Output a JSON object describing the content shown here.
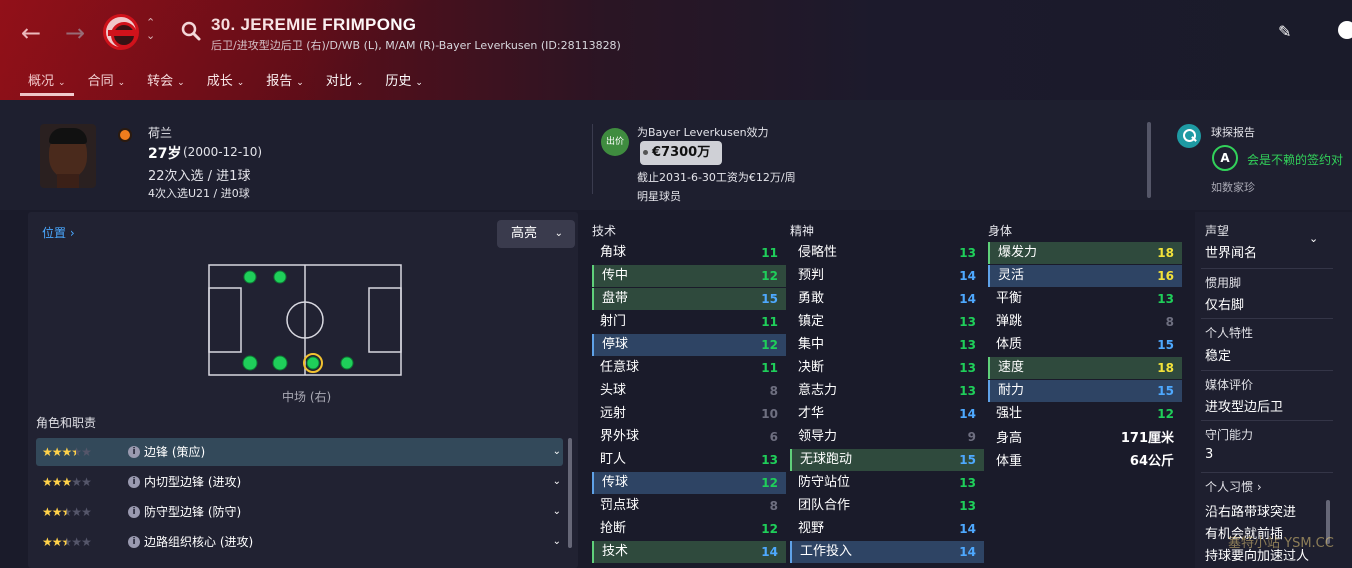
{
  "header": {
    "player_title": "30. JEREMIE FRIMPONG",
    "player_subtitle": "后卫/进攻型边后卫 (右)/D/WB (L), M/AM (R)-Bayer Leverkusen (ID:28113828)",
    "tabs": [
      {
        "label": "概况"
      },
      {
        "label": "合同"
      },
      {
        "label": "转会"
      },
      {
        "label": "成长"
      },
      {
        "label": "报告"
      },
      {
        "label": "对比"
      },
      {
        "label": "历史"
      }
    ],
    "icons": [
      "back-icon",
      "forward-icon",
      "club-crest",
      "up-down-icon",
      "search-icon",
      "edit-icon",
      "skull-icon"
    ]
  },
  "bio": {
    "nationality": "荷兰",
    "age": "27岁",
    "dob": "(2000-12-10)",
    "caps": "22次入选 / 进1球",
    "u21": "4次入选U21 / 进0球"
  },
  "contract": {
    "badge": "出价",
    "plays_for": "为Bayer Leverkusen效力",
    "value": "€7300万",
    "wage": "截止2031-6-30工资为€12万/周",
    "status": "明星球员"
  },
  "scout": {
    "title": "球探报告",
    "grade": "A",
    "verdict": "会是不赖的签约对",
    "scout_name": "如数家珍"
  },
  "position": {
    "link": "位置",
    "highlight_button": "高亮",
    "label": "中场 (右)"
  },
  "roles": {
    "title": "角色和职责",
    "items": [
      {
        "name": "边锋 (策应)",
        "stars": 3.5
      },
      {
        "name": "内切型边锋 (进攻)",
        "stars": 3
      },
      {
        "name": "防守型边锋 (防守)",
        "stars": 2.5
      },
      {
        "name": "边路组织核心 (进攻)",
        "stars": 2.5
      }
    ]
  },
  "attributes": {
    "technical": {
      "title": "技术",
      "items": [
        {
          "name": "角球",
          "value": "11",
          "hl": ""
        },
        {
          "name": "传中",
          "value": "12",
          "hl": "g"
        },
        {
          "name": "盘带",
          "value": "15",
          "hl": "g"
        },
        {
          "name": "射门",
          "value": "11",
          "hl": ""
        },
        {
          "name": "停球",
          "value": "12",
          "hl": "b"
        },
        {
          "name": "任意球",
          "value": "11",
          "hl": ""
        },
        {
          "name": "头球",
          "value": "8",
          "hl": ""
        },
        {
          "name": "远射",
          "value": "10",
          "hl": ""
        },
        {
          "name": "界外球",
          "value": "6",
          "hl": ""
        },
        {
          "name": "盯人",
          "value": "13",
          "hl": ""
        },
        {
          "name": "传球",
          "value": "12",
          "hl": "b"
        },
        {
          "name": "罚点球",
          "value": "8",
          "hl": ""
        },
        {
          "name": "抢断",
          "value": "12",
          "hl": ""
        },
        {
          "name": "技术",
          "value": "14",
          "hl": "g"
        }
      ]
    },
    "mental": {
      "title": "精神",
      "items": [
        {
          "name": "侵略性",
          "value": "13",
          "hl": ""
        },
        {
          "name": "预判",
          "value": "14",
          "hl": ""
        },
        {
          "name": "勇敢",
          "value": "14",
          "hl": ""
        },
        {
          "name": "镇定",
          "value": "13",
          "hl": ""
        },
        {
          "name": "集中",
          "value": "13",
          "hl": ""
        },
        {
          "name": "决断",
          "value": "13",
          "hl": ""
        },
        {
          "name": "意志力",
          "value": "13",
          "hl": ""
        },
        {
          "name": "才华",
          "value": "14",
          "hl": ""
        },
        {
          "name": "领导力",
          "value": "9",
          "hl": ""
        },
        {
          "name": "无球跑动",
          "value": "15",
          "hl": "g"
        },
        {
          "name": "防守站位",
          "value": "13",
          "hl": ""
        },
        {
          "name": "团队合作",
          "value": "13",
          "hl": ""
        },
        {
          "name": "视野",
          "value": "14",
          "hl": ""
        },
        {
          "name": "工作投入",
          "value": "14",
          "hl": "b"
        }
      ]
    },
    "physical": {
      "title": "身体",
      "items": [
        {
          "name": "爆发力",
          "value": "18",
          "hl": "g"
        },
        {
          "name": "灵活",
          "value": "16",
          "hl": "b"
        },
        {
          "name": "平衡",
          "value": "13",
          "hl": ""
        },
        {
          "name": "弹跳",
          "value": "8",
          "hl": ""
        },
        {
          "name": "体质",
          "value": "15",
          "hl": ""
        },
        {
          "name": "速度",
          "value": "18",
          "hl": "g"
        },
        {
          "name": "耐力",
          "value": "15",
          "hl": "b"
        },
        {
          "name": "强壮",
          "value": "12",
          "hl": ""
        }
      ],
      "height_label": "身高",
      "height": "171厘米",
      "weight_label": "体重",
      "weight": "64公斤"
    }
  },
  "profile": {
    "reputation_label": "声望",
    "reputation": "世界闻名",
    "foot_label": "惯用脚",
    "foot": "仅右脚",
    "personality_label": "个人特性",
    "personality": "稳定",
    "media_label": "媒体评价",
    "media": "进攻型边后卫",
    "gk_label": "守门能力",
    "gk": "3",
    "habits_label": "个人习惯",
    "habits": [
      "沿右路带球突进",
      "有机会就前插",
      "持球要向加速过人"
    ]
  },
  "watermark": "塞特小站 YSM.CC",
  "colors": {
    "value_green": "#1fcf5a",
    "value_blue": "#4ea9ff",
    "value_yellow": "#f2e23a",
    "value_dim": "#6e6f80",
    "highlight_green_bg": "#2f4a3d",
    "highlight_blue_bg": "#2e4464"
  }
}
